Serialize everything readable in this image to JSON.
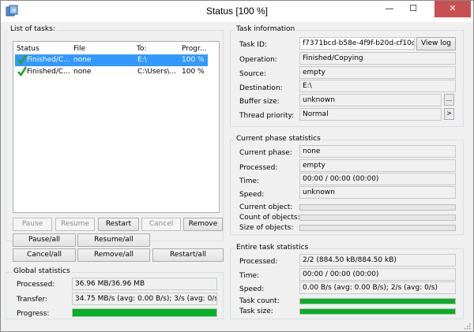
{
  "window": {
    "title": "Status [100 %]",
    "minimize": "—",
    "maximize": "☐",
    "close": "✕"
  },
  "tasks": {
    "group_label": "List of tasks:",
    "columns": [
      "Status",
      "File",
      "To:",
      "Progr..."
    ],
    "rows": [
      {
        "status": "Finished/C...",
        "file": "none",
        "to": "E:\\",
        "progress": "100 %",
        "selected": true
      },
      {
        "status": "Finished/C...",
        "file": "none",
        "to": "C:\\Users\\...",
        "progress": "100 %",
        "selected": false
      }
    ]
  },
  "task_buttons": {
    "pause": "Pause",
    "resume": "Resume",
    "restart": "Restart",
    "cancel": "Cancel",
    "remove": "Remove",
    "pause_all": "Pause/all",
    "resume_all": "Resume/all",
    "cancel_all": "Cancel/all",
    "remove_all": "Remove/all",
    "restart_all": "Restart/all"
  },
  "global_stats": {
    "group_label": "Global statistics",
    "processed_label": "Processed:",
    "processed_value": "36.96 MB/36.96 MB",
    "transfer_label": "Transfer:",
    "transfer_value": "34.75 MB/s (avg: 0.00 B/s); 3/s (avg: 0/s)",
    "progress_label": "Progress:",
    "progress_fraction": 1.0
  },
  "task_info": {
    "group_label": "Task information",
    "task_id_label": "Task ID:",
    "task_id_value": "f7371bcd-b58e-4f9f-b20d-cf10dbaa",
    "view_log": "View log",
    "operation_label": "Operation:",
    "operation_value": "Finished/Copying",
    "source_label": "Source:",
    "source_value": "empty",
    "destination_label": "Destination:",
    "destination_value": "E:\\",
    "buffer_label": "Buffer size:",
    "buffer_value": "unknown",
    "buffer_btn": "...",
    "thread_label": "Thread priority:",
    "thread_value": "Normal",
    "thread_btn": ">"
  },
  "phase_stats": {
    "group_label": "Current phase statistics",
    "phase_label": "Current phase:",
    "phase_value": "none",
    "processed_label": "Processed:",
    "processed_value": "empty",
    "time_label": "Time:",
    "time_value": "00:00 / 00:00 (00:00)",
    "speed_label": "Speed:",
    "speed_value": "unknown",
    "object_label": "Current object:",
    "count_label": "Count of objects:",
    "size_label": "Size of objects:",
    "object_fraction": 0,
    "count_fraction": 0,
    "size_fraction": 0
  },
  "entire_stats": {
    "group_label": "Entire task statistics",
    "processed_label": "Processed:",
    "processed_value": "2/2 (884.50 kB/884.50 kB)",
    "time_label": "Time:",
    "time_value": "00:00 / 00:00 (00:00)",
    "speed_label": "Speed:",
    "speed_value": "0.00 B/s (avg: 0.00 B/s); 2/s (avg: 0/s)",
    "count_label": "Task count:",
    "size_label": "Task size:",
    "count_fraction": 1.0,
    "size_fraction": 1.0
  },
  "colors": {
    "progress_fill": "#06b025",
    "selection": "#3399ff",
    "close_button": "#c75050",
    "check": "#2e9e2e"
  }
}
